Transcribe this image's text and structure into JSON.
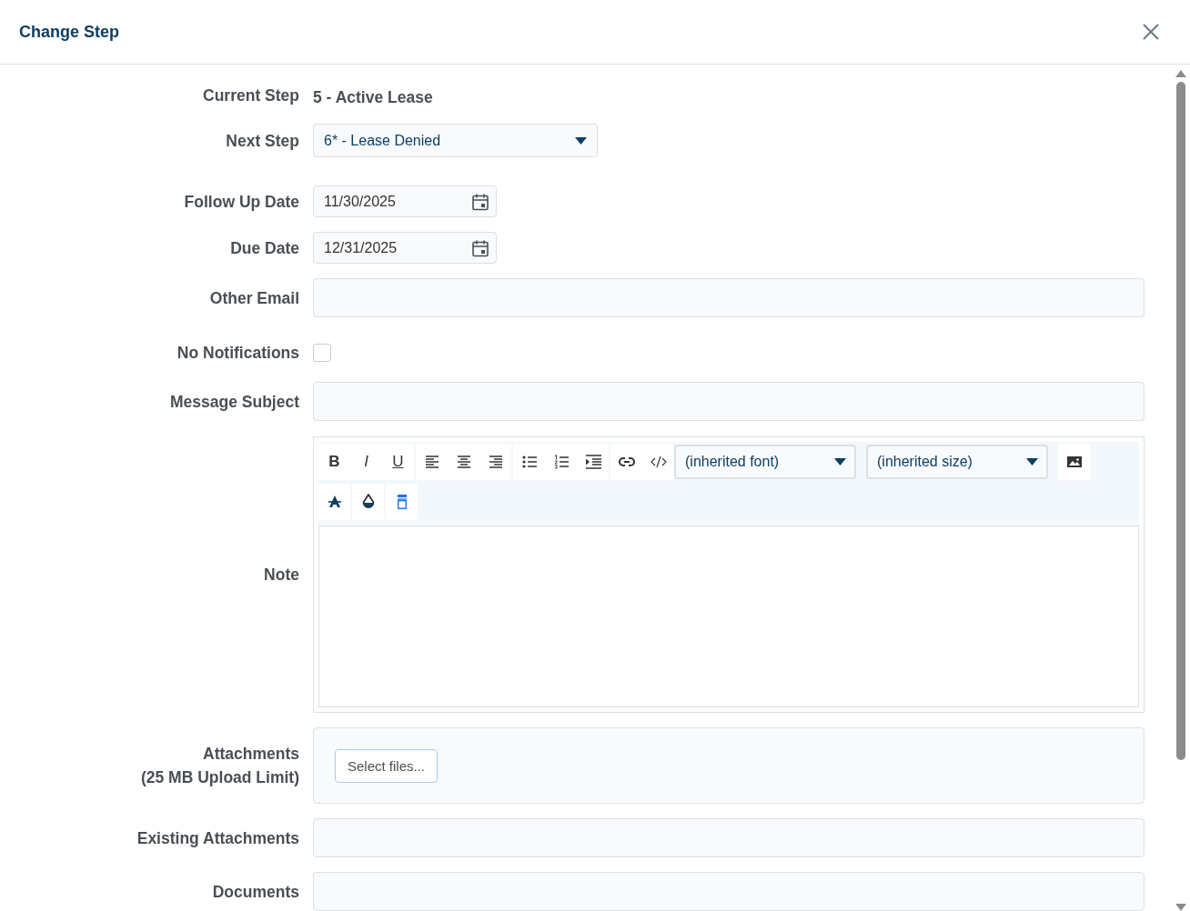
{
  "dialog": {
    "title": "Change Step"
  },
  "fields": [
    {
      "kind": "static",
      "label": "Current Step",
      "value": "5 - Active Lease"
    },
    {
      "kind": "select",
      "label": "Next Step",
      "value": "6* - Lease Denied"
    },
    {
      "kind": "date",
      "label": "Follow Up Date",
      "value": "11/30/2025"
    },
    {
      "kind": "date",
      "label": "Due Date",
      "value": "12/31/2025"
    },
    {
      "kind": "input",
      "label": "Other Email"
    },
    {
      "kind": "checkbox",
      "label": "No Notifications",
      "checked": false
    },
    {
      "kind": "input",
      "label": "Message Subject"
    },
    {
      "kind": "editor",
      "label": "Note"
    },
    {
      "kind": "upload",
      "label": "Attachments",
      "sublabel": "(25 MB Upload Limit)",
      "button": "Select files..."
    },
    {
      "kind": "box",
      "label": "Existing Attachments"
    },
    {
      "kind": "box",
      "label": "Documents"
    }
  ],
  "editor": {
    "rows": [
      [
        {
          "kind": "bold",
          "label": "B"
        },
        {
          "kind": "italic",
          "label": "I"
        },
        {
          "kind": "underline",
          "label": "U"
        },
        {
          "kind": "sep"
        },
        {
          "kind": "align-left"
        },
        {
          "kind": "align-center"
        },
        {
          "kind": "align-right"
        },
        {
          "kind": "sep"
        },
        {
          "kind": "bullets"
        },
        {
          "kind": "numbers"
        },
        {
          "kind": "indent"
        },
        {
          "kind": "sep"
        },
        {
          "kind": "link"
        },
        {
          "kind": "code"
        },
        {
          "kind": "select",
          "label": "(inherited font)"
        },
        {
          "kind": "select",
          "label": "(inherited size)"
        },
        {
          "kind": "image"
        }
      ],
      [
        {
          "kind": "font-color"
        },
        {
          "kind": "sep"
        },
        {
          "kind": "back-color"
        },
        {
          "kind": "sep"
        },
        {
          "kind": "view-html"
        }
      ]
    ]
  }
}
